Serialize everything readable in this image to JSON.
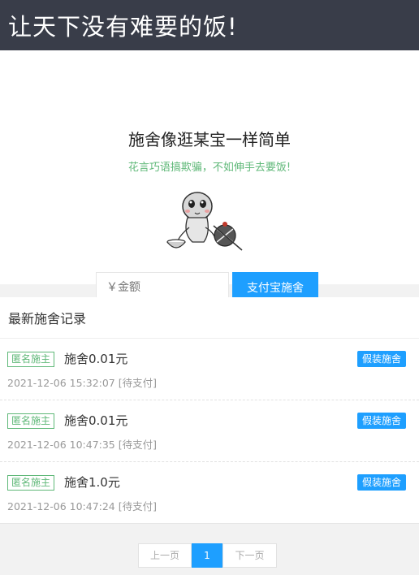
{
  "header": {
    "title": "让天下没有难要的饭!"
  },
  "hero": {
    "title": "施舍像逛某宝一样简单",
    "subtitle": "花言巧语搞欺骗，不如伸手去要饭!",
    "amount_placeholder": "￥金额",
    "donate_button": "支付宝施舍"
  },
  "records": {
    "heading": "最新施舍记录",
    "items": [
      {
        "badge": "匿名施主",
        "amount": "施舍0.01元",
        "time": "2021-12-06 15:32:07",
        "status": "[待支付]",
        "action": "假装施舍"
      },
      {
        "badge": "匿名施主",
        "amount": "施舍0.01元",
        "time": "2021-12-06 10:47:35",
        "status": "[待支付]",
        "action": "假装施舍"
      },
      {
        "badge": "匿名施主",
        "amount": "施舍1.0元",
        "time": "2021-12-06 10:47:24",
        "status": "[待支付]",
        "action": "假装施舍"
      }
    ]
  },
  "pager": {
    "prev": "上一页",
    "current": "1",
    "next": "下一页"
  },
  "colors": {
    "header_bg": "#393d49",
    "accent_blue": "#1e9fff",
    "accent_green": "#5fb878"
  },
  "icons": {
    "mascot": "beggar-mascot-illustration"
  }
}
